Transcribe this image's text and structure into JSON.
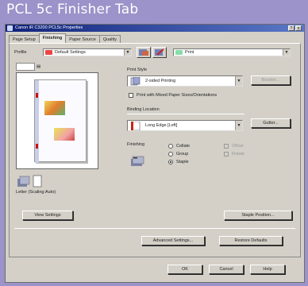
{
  "frame": {
    "title": "PCL 5c Finisher Tab"
  },
  "window": {
    "title": "Canon iR C3200 PCL5c Properties",
    "help_btn": "?",
    "close_btn": "x"
  },
  "tabs": [
    {
      "label": "Page Setup",
      "active": false
    },
    {
      "label": "Finishing",
      "active": true
    },
    {
      "label": "Paper Source",
      "active": false
    },
    {
      "label": "Quality",
      "active": false
    }
  ],
  "profile": {
    "label": "Profile",
    "value": "Default Settings",
    "output_value": "Print"
  },
  "preview": {
    "caption": "Letter (Scaling:Auto)",
    "view_settings_btn": "View Settings"
  },
  "print_style": {
    "label": "Print Style",
    "value": "2-sided Printing",
    "booklet_btn": "Booklet...",
    "mixed_checkbox": "Print with Mixed Paper Sizes/Orientations"
  },
  "binding": {
    "label": "Binding Location",
    "value": "Long Edge [Left]",
    "gutter_btn": "Gutter..."
  },
  "finishing": {
    "label": "Finishing",
    "options": [
      {
        "label": "Collate",
        "selected": false
      },
      {
        "label": "Group",
        "selected": false
      },
      {
        "label": "Staple",
        "selected": true
      }
    ],
    "checks": [
      {
        "label": "Offset",
        "enabled": false
      },
      {
        "label": "Rotate",
        "enabled": false
      }
    ],
    "staple_position_btn": "Staple Position..."
  },
  "bottom": {
    "advanced_btn": "Advanced Settings...",
    "restore_btn": "Restore Defaults",
    "ok_btn": "OK",
    "cancel_btn": "Cancel",
    "help_btn": "Help"
  }
}
